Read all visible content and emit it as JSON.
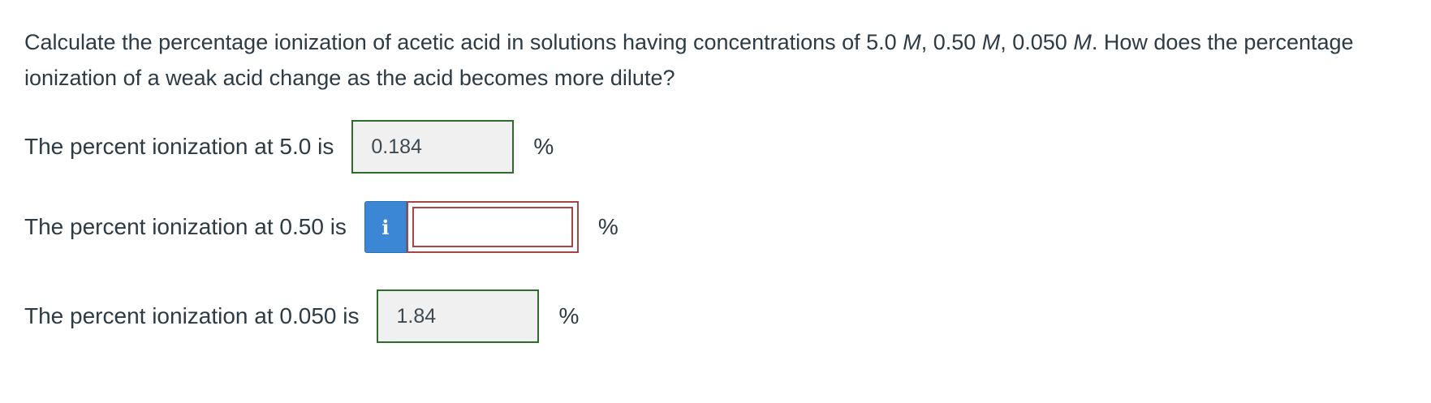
{
  "question": {
    "part1": "Calculate the percentage ionization of acetic acid in solutions having concentrations of 5.0 ",
    "unit_m": "M",
    "sep1": ", 0.50 ",
    "sep2": ", 0.050 ",
    "part2": ". How does the percentage ionization of a weak acid change as the acid becomes more dilute?"
  },
  "rows": [
    {
      "label": "The percent ionization at 5.0 is",
      "value": "0.184",
      "unit": "%"
    },
    {
      "label": "The percent ionization at 0.50 is",
      "value": "",
      "info_icon": "i",
      "unit": "%"
    },
    {
      "label": "The percent ionization at 0.050 is",
      "value": "1.84",
      "unit": "%"
    }
  ],
  "colors": {
    "correct_border": "#2f6b2c",
    "incorrect_border": "#a04848",
    "info_button": "#3b87d6"
  },
  "icons": {
    "info": "info-icon"
  }
}
